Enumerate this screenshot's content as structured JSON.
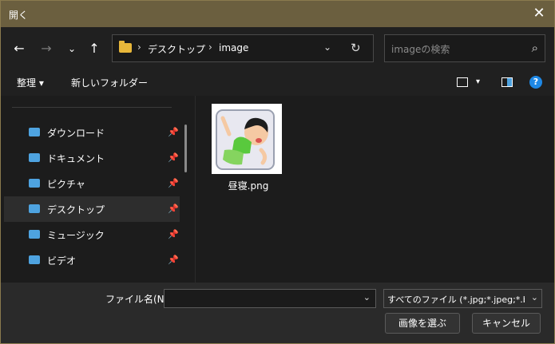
{
  "window": {
    "title": "開く"
  },
  "nav": {
    "address_crumbs": [
      "デスクトップ",
      "image"
    ],
    "search_placeholder": "imageの検索"
  },
  "toolbar": {
    "organize_label": "整理 ▾",
    "new_folder_label": "新しいフォルダー"
  },
  "sidebar": {
    "items": [
      {
        "label": "ダウンロード",
        "selected": false
      },
      {
        "label": "ドキュメント",
        "selected": false
      },
      {
        "label": "ピクチャ",
        "selected": false
      },
      {
        "label": "デスクトップ",
        "selected": true
      },
      {
        "label": "ミュージック",
        "selected": false
      },
      {
        "label": "ビデオ",
        "selected": false
      }
    ]
  },
  "files": [
    {
      "name": "昼寝.png"
    }
  ],
  "bottom": {
    "filename_label": "ファイル名(N):",
    "filename_value": "",
    "filetype_value": "すべてのファイル (*.jpg;*.jpeg;*.bmp",
    "open_button": "画像を選ぶ",
    "cancel_button": "キャンセル"
  },
  "colors": {
    "titlebar": "#6b5f3f",
    "background": "#1c1c1c",
    "folder": "#e8b73a",
    "accent": "#4ea3e0"
  }
}
